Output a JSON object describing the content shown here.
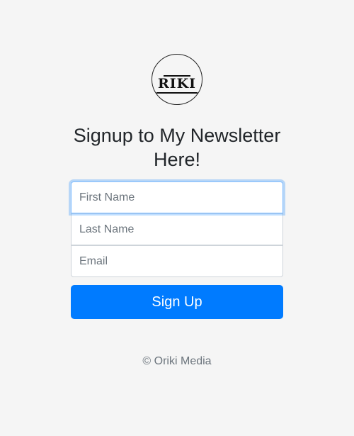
{
  "logo": {
    "text": "RIKI",
    "icon": "oriki-logo"
  },
  "heading": "Signup to My Newsletter Here!",
  "form": {
    "first_name_placeholder": "First Name",
    "last_name_placeholder": "Last Name",
    "email_placeholder": "Email",
    "submit_label": "Sign Up"
  },
  "footer": {
    "copyright": "© Oriki Media"
  },
  "colors": {
    "background": "#f5f5f5",
    "primary": "#007bff",
    "focus_ring": "#80bdff"
  }
}
